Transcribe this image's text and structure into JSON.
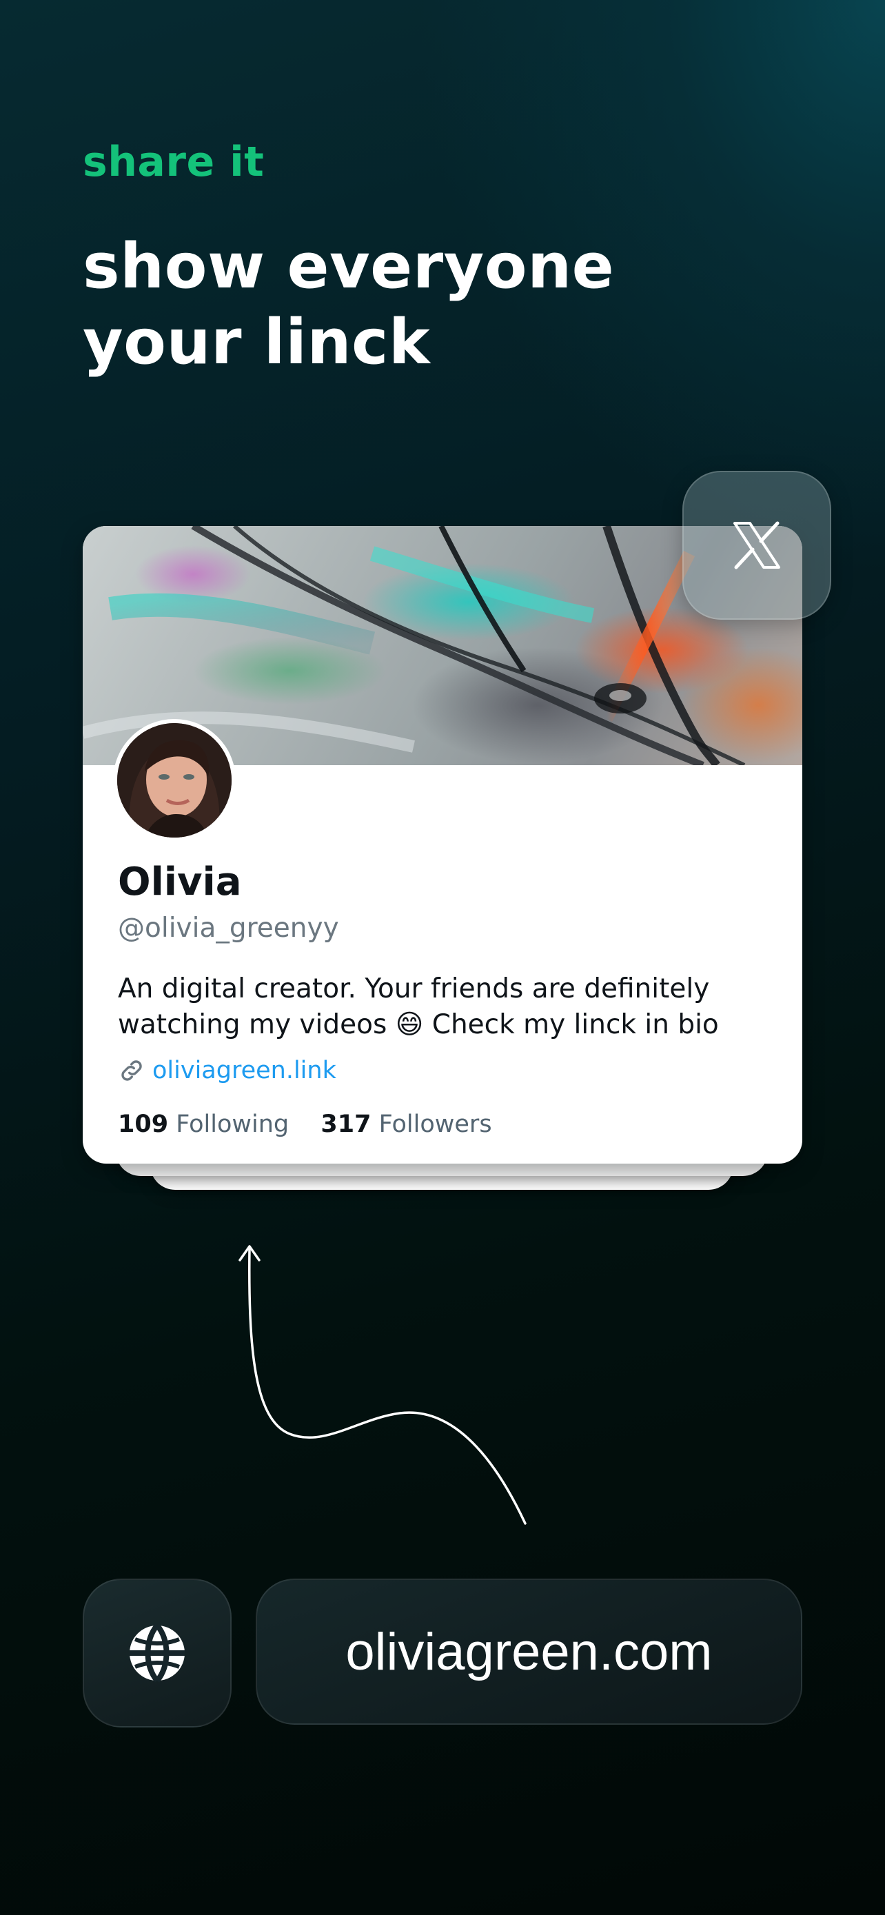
{
  "hero": {
    "eyebrow": "share it",
    "headline": "show everyone your linck"
  },
  "profile_card": {
    "name": "Olivia",
    "handle": "@olivia_greenyy",
    "bio": "An digital creator. Your friends are definitely watching my videos 😄 Check my linck in bio",
    "link": "oliviagreen.link",
    "following_count": "109",
    "following_label": "Following",
    "followers_count": "317",
    "followers_label": "Followers"
  },
  "social_badge": {
    "icon": "x-logo-icon"
  },
  "footer": {
    "globe_icon": "globe-icon",
    "url": "oliviagreen.com"
  },
  "colors": {
    "accent": "#14c27a",
    "link": "#1d9bf0",
    "text_primary": "#0f1419",
    "text_secondary": "#536471"
  }
}
